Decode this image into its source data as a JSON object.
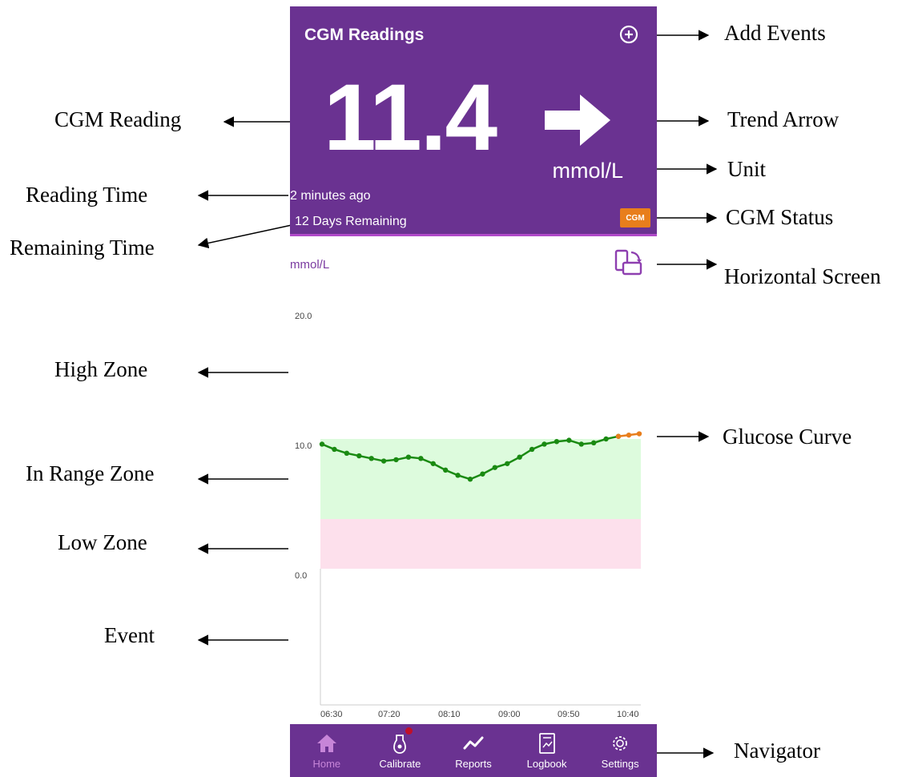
{
  "header": {
    "title": "CGM Readings"
  },
  "reading": {
    "value": "11.4",
    "unit": "mmol/L",
    "time": "2 minutes ago",
    "remaining": "12 Days Remaining",
    "status_badge": "CGM"
  },
  "chart": {
    "unit_label": "mmol/L",
    "y_labels": [
      "20.0",
      "10.0",
      "0.0"
    ],
    "x_labels": [
      "06:30",
      "07:20",
      "08:10",
      "09:00",
      "09:50",
      "10:40"
    ]
  },
  "chart_data": {
    "type": "line",
    "x_ticks": [
      "06:30",
      "07:20",
      "08:10",
      "09:00",
      "09:50",
      "10:40"
    ],
    "y_ticks": [
      "20.0",
      "10.0",
      "0.0"
    ],
    "ylabel": "mmol/L",
    "zones": [
      {
        "name": "High Zone"
      },
      {
        "name": "In Range Zone",
        "color": "#ddfbdd"
      },
      {
        "name": "Low Zone",
        "color": "#fde0ec"
      }
    ],
    "series": [
      {
        "color": "#1a8a12",
        "values": [
          9.6,
          9.2,
          8.9,
          8.7,
          8.5,
          8.3,
          8.4,
          8.6,
          8.5,
          8.1,
          7.6,
          7.2,
          6.9,
          7.3,
          7.8,
          8.1,
          8.6,
          9.2,
          9.6,
          9.8,
          9.9,
          9.6,
          9.7,
          10.0,
          10.2
        ]
      },
      {
        "color": "#e87e1c",
        "values": [
          10.2,
          10.3,
          10.4
        ]
      }
    ]
  },
  "nav": {
    "items": [
      {
        "label": "Home",
        "icon": "home-icon"
      },
      {
        "label": "Calibrate",
        "icon": "blood-drop-icon"
      },
      {
        "label": "Reports",
        "icon": "trend-line-icon"
      },
      {
        "label": "Logbook",
        "icon": "logbook-icon"
      },
      {
        "label": "Settings",
        "icon": "gear-icon"
      }
    ]
  },
  "annotations": {
    "add_events": "Add Events",
    "cgm_reading": "CGM Reading",
    "trend_arrow": "Trend Arrow",
    "unit": "Unit",
    "reading_time": "Reading Time",
    "cgm_status": "CGM Status",
    "remaining_time": "Remaining Time",
    "horizontal_screen": "Horizontal Screen",
    "high_zone": "High Zone",
    "glucose_curve": "Glucose Curve",
    "in_range_zone": "In Range Zone",
    "low_zone": "Low Zone",
    "event": "Event",
    "navigator": "Navigator"
  },
  "colors": {
    "header_purple": "#6a3291",
    "in_range": "#ddfbdd",
    "low": "#fde0ec",
    "curve_green": "#1a8a12",
    "curve_orange": "#e87e1c",
    "badge": "#e87e1c"
  }
}
